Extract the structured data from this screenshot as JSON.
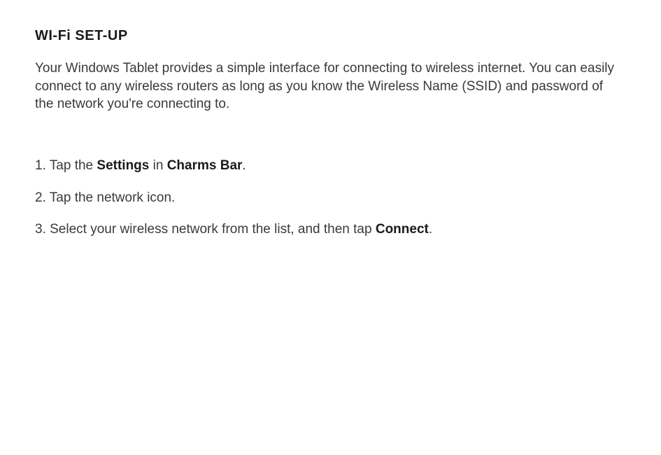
{
  "title": "WI-Fi SET-UP",
  "intro": "Your Windows Tablet provides a simple interface for connecting to wireless internet. You can easily connect to any wireless routers as long as you know the Wireless Name (SSID) and password of the network you're connecting to.",
  "steps": {
    "s1": {
      "num": "1. ",
      "p1": "Tap the ",
      "b1": "Settings",
      "p2": " in ",
      "b2": "Charms Bar",
      "p3": "."
    },
    "s2": {
      "num": "2. ",
      "text": "Tap the network icon."
    },
    "s3": {
      "num": "3. ",
      "p1": "Select your wireless network from the list, and then tap ",
      "b1": "Connect",
      "p2": "."
    }
  }
}
